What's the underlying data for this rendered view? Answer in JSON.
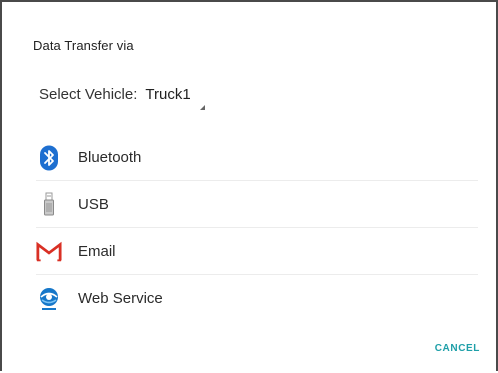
{
  "dialog": {
    "title": "Data Transfer via",
    "vehicle_label": "Select Vehicle:",
    "vehicle_value": "Truck1",
    "options": [
      {
        "label": "Bluetooth",
        "icon": "bluetooth-icon"
      },
      {
        "label": "USB",
        "icon": "usb-icon"
      },
      {
        "label": "Email",
        "icon": "gmail-icon"
      },
      {
        "label": "Web Service",
        "icon": "web-service-icon"
      }
    ],
    "cancel_label": "CANCEL"
  },
  "colors": {
    "accent": "#1e9fa8",
    "bluetooth": "#1e6fd0",
    "gmail_red": "#d93025",
    "web_blue": "#1677c9"
  }
}
